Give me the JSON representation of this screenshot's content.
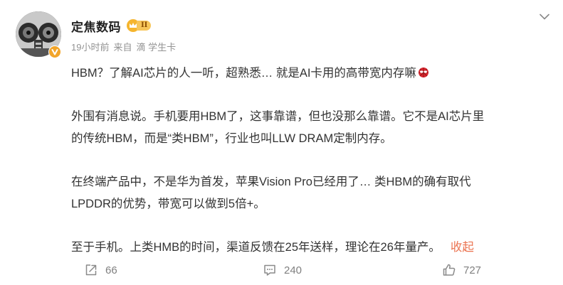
{
  "post": {
    "author": {
      "name": "定焦数码",
      "vip_level": "II"
    },
    "meta": {
      "time": "19小时前",
      "source_prefix": "来自",
      "source_name": "滴 学生卡"
    },
    "content": {
      "para1": "HBM？了解AI芯片的人一听，超熟悉… 就是AI卡用的高带宽内存嘛",
      "para2_line1": "外围有消息说。手机要用HBM了，这事靠谱，但也没那么靠谱。它不是AI芯片里",
      "para2_line2": "的传统HBM，而是“类HBM”，行业也叫LLW DRAM定制内存。",
      "para3_line1": "在终端产品中，不是华为首发，苹果Vision Pro已经用了… 类HBM的确有取代",
      "para3_line2": "LPDDR的优势，带宽可以做到5倍+。",
      "para4": "至于手机。上类HMB的时间，渠道反馈在25年送样，理论在26年量产。",
      "collapse_label": "收起"
    },
    "actions": {
      "share_count": "66",
      "comment_count": "240",
      "like_count": "727"
    },
    "icons": {
      "more": "chevron-down-icon",
      "share": "share-icon",
      "comment": "comment-icon",
      "like": "thumbs-up-icon",
      "emoji": "spider-face-emoji-icon"
    },
    "colors": {
      "link": "#eb7350",
      "meta": "#939393",
      "text": "#333333",
      "vip_gold": "#f5b52e"
    }
  }
}
